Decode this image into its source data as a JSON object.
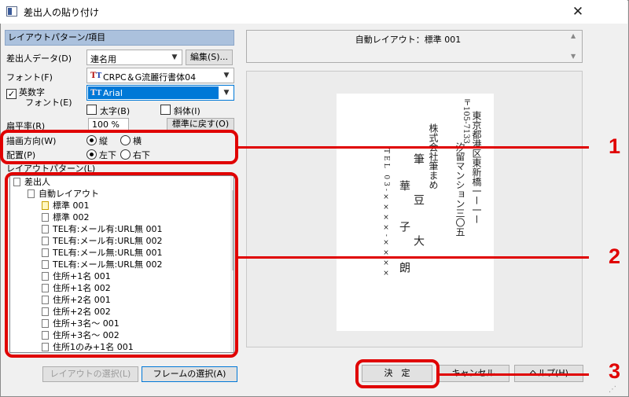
{
  "window": {
    "title": "差出人の貼り付け",
    "close_glyph": "✕"
  },
  "left_panel": {
    "section_header": "レイアウトパターン/項目",
    "sender_data": {
      "label": "差出人データ(D)",
      "value": "連名用",
      "edit_button": "編集(S)..."
    },
    "font": {
      "label": "フォント(F)",
      "value": "CRPC＆G流麗行書体04"
    },
    "alnum_font": {
      "checked": true,
      "check_glyph": "✓",
      "label_line1": "英数字",
      "label_line2": "フォント(E)",
      "value": "Arial"
    },
    "bold": {
      "label": "太字(B)",
      "checked": false
    },
    "italic": {
      "label": "斜体(I)",
      "checked": false
    },
    "flatten": {
      "label": "扁平率(R)",
      "value": "100 %",
      "reset_button": "標準に戻す(O)"
    },
    "direction": {
      "label": "描画方向(W)",
      "options": [
        "縦",
        "横"
      ],
      "selected": "縦"
    },
    "placement": {
      "label": "配置(P)",
      "options": [
        "左下",
        "右下"
      ],
      "selected": "左下"
    },
    "layout_pattern_label": "レイアウトパターン(L)",
    "tree": {
      "root": "差出人",
      "group": "自動レイアウト",
      "items": [
        "標準 001",
        "標準 002",
        "TEL有:メール有:URL無 001",
        "TEL有:メール有:URL無 002",
        "TEL有:メール無:URL無 001",
        "TEL有:メール無:URL無 002",
        "住所+1名 001",
        "住所+1名 002",
        "住所+2名 001",
        "住所+2名 002",
        "住所+3名～ 001",
        "住所+3名～ 002",
        "住所1のみ+1名 001"
      ],
      "selected_item": "標準 001"
    }
  },
  "right_panel": {
    "preview_title": "自動レイアウト：標準 001",
    "card": {
      "postal": "〒105-7133",
      "address1": "東京都港区東新橋一ー一ー",
      "address2": "汐留マンション三〇五",
      "company": "株式会社筆まめ",
      "name_col1": "筆　豆　大",
      "name_col2": "華　子　朗",
      "tel": "TEL 03-××××-××××"
    }
  },
  "bottom": {
    "select_layout_button": "レイアウトの選択(L)",
    "select_frame_button": "フレームの選択(A)",
    "ok_button": "決　定",
    "cancel_button": "キャンセル",
    "help_button": "ヘルプ(H)"
  },
  "annotations": [
    "1",
    "2",
    "3"
  ],
  "colors": {
    "annotation": "#e00000",
    "section_header": "#abc1dd",
    "selection": "#0078d7"
  }
}
